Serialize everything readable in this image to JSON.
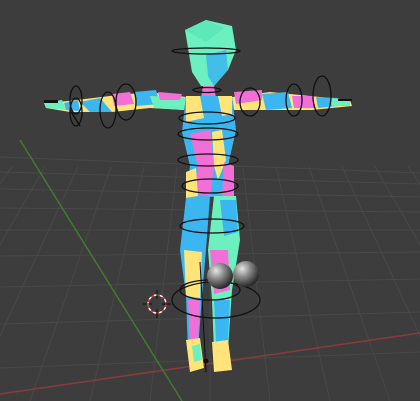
{
  "viewport": {
    "background": "#3d3d3d",
    "grid_color": "#484848",
    "x_axis_color": "#8a3b3b",
    "y_axis_color": "#3f7a2f"
  },
  "model": {
    "palette": {
      "cyan": "#3bb6f0",
      "mint": "#6cf0c0",
      "magenta": "#f36fd8",
      "yellow": "#ffe47a"
    }
  },
  "gizmos": {
    "bone_ring_color": "#101010",
    "sphere_color": "#8a8a8a"
  },
  "icons": {
    "cursor": "3d-cursor-icon",
    "sphere": "empty-sphere-icon"
  }
}
